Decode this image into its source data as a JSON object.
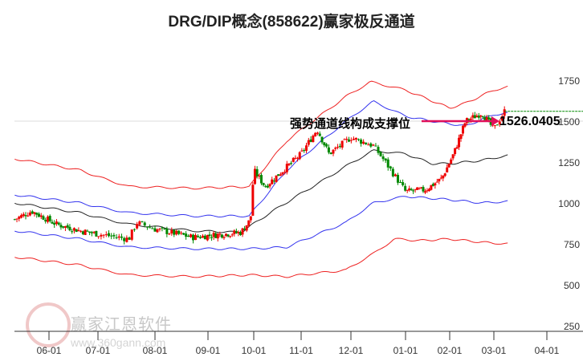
{
  "chart_data": {
    "type": "candlestick",
    "title": "DRG/DIP概念(858622)赢家极反通道",
    "annotation": "强势通道线构成支撑位",
    "last_price_label": "1526.0405",
    "x_ticks": [
      "06-01",
      "07-01",
      "08-01",
      "09-01",
      "10-01",
      "11-01",
      "12-01",
      "01-01",
      "02-01",
      "03-01",
      "04-01"
    ],
    "y_ticks": [
      250,
      500,
      750,
      1000,
      1250,
      1500,
      1750
    ],
    "ylim": [
      250,
      1800
    ],
    "x_unit": "month index from 06-01",
    "close_anchors": [
      [
        -0.7,
        900
      ],
      [
        -0.35,
        950
      ],
      [
        0.15,
        870
      ],
      [
        0.64,
        830
      ],
      [
        1.0,
        810
      ],
      [
        1.54,
        780
      ],
      [
        1.68,
        880
      ],
      [
        2.0,
        840
      ],
      [
        2.71,
        790
      ],
      [
        3.0,
        800
      ],
      [
        3.72,
        820
      ],
      [
        3.93,
        900
      ],
      [
        4.0,
        1200
      ],
      [
        4.24,
        1100
      ],
      [
        5.0,
        1300
      ],
      [
        5.32,
        1450
      ],
      [
        5.56,
        1300
      ],
      [
        6.0,
        1400
      ],
      [
        6.41,
        1350
      ],
      [
        6.63,
        1250
      ],
      [
        7.0,
        1070
      ],
      [
        7.45,
        1080
      ],
      [
        7.82,
        1150
      ],
      [
        8.09,
        1300
      ],
      [
        8.36,
        1500
      ],
      [
        8.73,
        1550
      ],
      [
        9.0,
        1450
      ],
      [
        9.2,
        1560
      ]
    ],
    "bands": [
      {
        "name": "middle",
        "color": "#222222",
        "points": [
          [
            -0.7,
            1000
          ],
          [
            0.64,
            940
          ],
          [
            1.54,
            870
          ],
          [
            2.71,
            830
          ],
          [
            3.72,
            820
          ],
          [
            4.4,
            950
          ],
          [
            5.4,
            1130
          ],
          [
            6.41,
            1320
          ],
          [
            7.0,
            1300
          ],
          [
            7.6,
            1240
          ],
          [
            8.0,
            1240
          ],
          [
            8.73,
            1260
          ],
          [
            9.27,
            1290
          ]
        ]
      },
      {
        "name": "upper-blue",
        "color": "#3333ee",
        "points": [
          [
            -0.7,
            1050
          ],
          [
            0.64,
            1000
          ],
          [
            1.54,
            940
          ],
          [
            2.71,
            920
          ],
          [
            3.9,
            920
          ],
          [
            4.7,
            1200
          ],
          [
            5.9,
            1500
          ],
          [
            6.41,
            1620
          ],
          [
            7.0,
            1530
          ],
          [
            7.6,
            1500
          ],
          [
            8.36,
            1470
          ],
          [
            9.0,
            1540
          ],
          [
            9.27,
            1550
          ]
        ]
      },
      {
        "name": "lower-blue",
        "color": "#3333ee",
        "points": [
          [
            -0.7,
            830
          ],
          [
            0.64,
            780
          ],
          [
            1.54,
            730
          ],
          [
            2.71,
            720
          ],
          [
            3.9,
            720
          ],
          [
            4.7,
            730
          ],
          [
            5.9,
            880
          ],
          [
            6.41,
            1000
          ],
          [
            7.0,
            1040
          ],
          [
            8.0,
            1020
          ],
          [
            8.73,
            1000
          ],
          [
            9.27,
            1010
          ]
        ]
      },
      {
        "name": "upper-red",
        "color": "#ee2222",
        "points": [
          [
            -0.7,
            1270
          ],
          [
            0.64,
            1200
          ],
          [
            1.54,
            1100
          ],
          [
            2.71,
            1090
          ],
          [
            3.9,
            1100
          ],
          [
            4.7,
            1380
          ],
          [
            5.9,
            1650
          ],
          [
            6.36,
            1740
          ],
          [
            7.0,
            1690
          ],
          [
            8.0,
            1580
          ],
          [
            8.36,
            1610
          ],
          [
            9.0,
            1690
          ],
          [
            9.27,
            1710
          ]
        ]
      },
      {
        "name": "lower-red",
        "color": "#ee2222",
        "points": [
          [
            -0.7,
            670
          ],
          [
            0.64,
            620
          ],
          [
            1.54,
            560
          ],
          [
            2.71,
            550
          ],
          [
            3.9,
            560
          ],
          [
            4.7,
            550
          ],
          [
            5.9,
            590
          ],
          [
            6.41,
            690
          ],
          [
            6.8,
            780
          ],
          [
            7.3,
            770
          ],
          [
            8.0,
            780
          ],
          [
            8.73,
            760
          ],
          [
            9.27,
            750
          ]
        ]
      }
    ]
  },
  "watermark": {
    "name": "赢家江恩软件",
    "url": "www.360gann.com"
  }
}
